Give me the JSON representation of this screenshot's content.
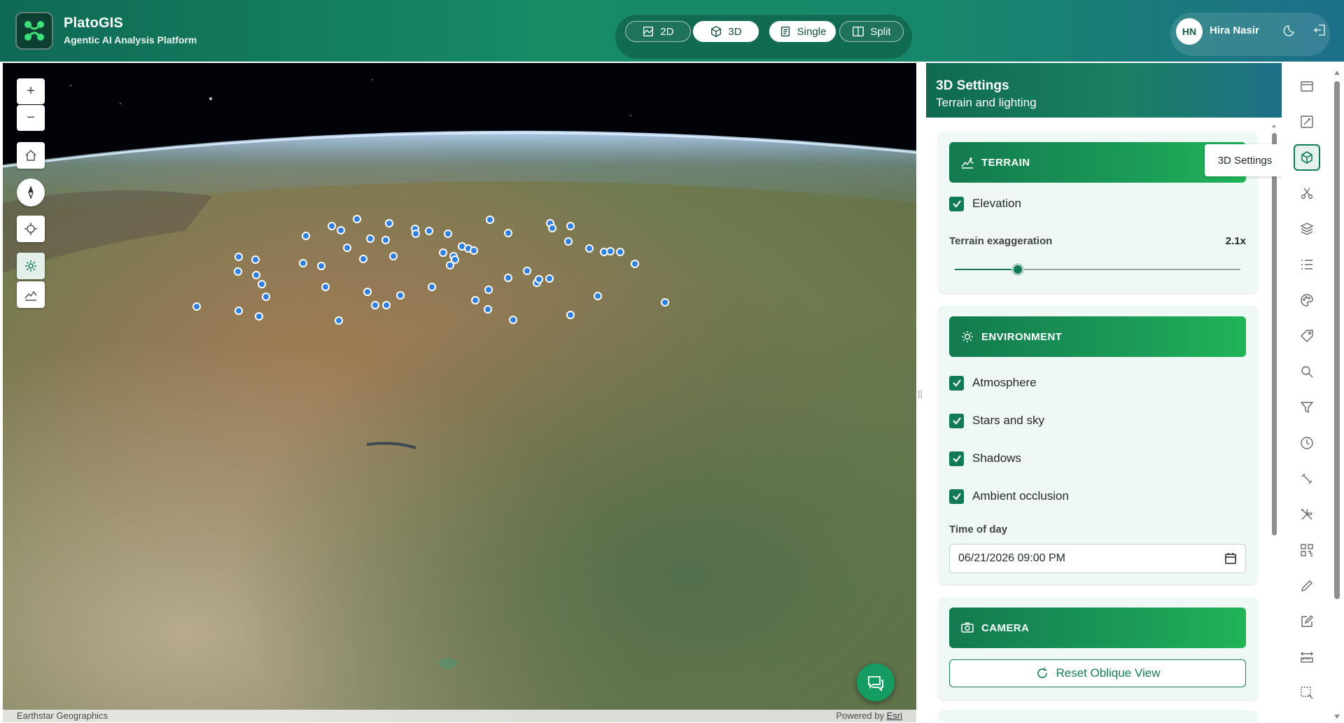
{
  "header": {
    "app_name": "PlatoGIS",
    "app_subtitle": "Agentic AI Analysis Platform",
    "modes": [
      {
        "label": "2D",
        "icon": "map-2d-icon",
        "active": false
      },
      {
        "label": "3D",
        "icon": "cube-icon",
        "active": true
      },
      {
        "label": "Single",
        "icon": "single-view-icon",
        "active": true
      },
      {
        "label": "Split",
        "icon": "split-view-icon",
        "active": false
      }
    ],
    "user": {
      "initials": "HN",
      "name": "Hira Nasir"
    },
    "icons": [
      "dark-mode-moon-icon",
      "logout-icon"
    ]
  },
  "map": {
    "controls": [
      "zoom-in-icon",
      "zoom-out-icon",
      "home-icon",
      "compass-icon",
      "locate-icon",
      "settings-icon",
      "terrain-profile-icon"
    ],
    "zoom_in_label": "+",
    "zoom_out_label": "−",
    "attribution_left": "Earthstar Geographics",
    "attribution_right_prefix": "Powered by ",
    "attribution_right_link": "Esri"
  },
  "panel": {
    "title": "3D Settings",
    "subtitle": "Terrain and lighting",
    "terrain": {
      "heading": "TERRAIN",
      "elevation_label": "Elevation",
      "elevation_checked": true,
      "exaggeration_label": "Terrain exaggeration",
      "exaggeration_value": "2.1x",
      "exaggeration_fraction": 0.22
    },
    "environment": {
      "heading": "ENVIRONMENT",
      "options": [
        {
          "label": "Atmosphere",
          "checked": true
        },
        {
          "label": "Stars and sky",
          "checked": true
        },
        {
          "label": "Shadows",
          "checked": true
        },
        {
          "label": "Ambient occlusion",
          "checked": true
        }
      ],
      "time_label": "Time of day",
      "time_value": "06/21/2026 09:00 PM"
    },
    "camera": {
      "heading": "CAMERA",
      "reset_label": "Reset Oblique View"
    }
  },
  "tooltip": "3D Settings",
  "toolbar": {
    "tools": [
      "basemap-icon",
      "map-edit-icon",
      "3d-settings-cube-icon",
      "scissors-clip-icon",
      "layers-icon",
      "legend-list-icon",
      "style-palette-icon",
      "tag-label-icon",
      "search-icon",
      "filter-icon",
      "history-clock-icon",
      "pin-tool-icon",
      "tools-icon",
      "qr-grid-icon",
      "draw-pencil-icon",
      "edit-note-icon",
      "measure-icon",
      "select-area-icon"
    ],
    "active_tool": "3d-settings-cube-icon"
  },
  "colors": {
    "brand_green": "#127a55",
    "header_start": "#0f6a54",
    "section_green": "#1a9a57",
    "marker_blue": "#2f7fe0"
  }
}
